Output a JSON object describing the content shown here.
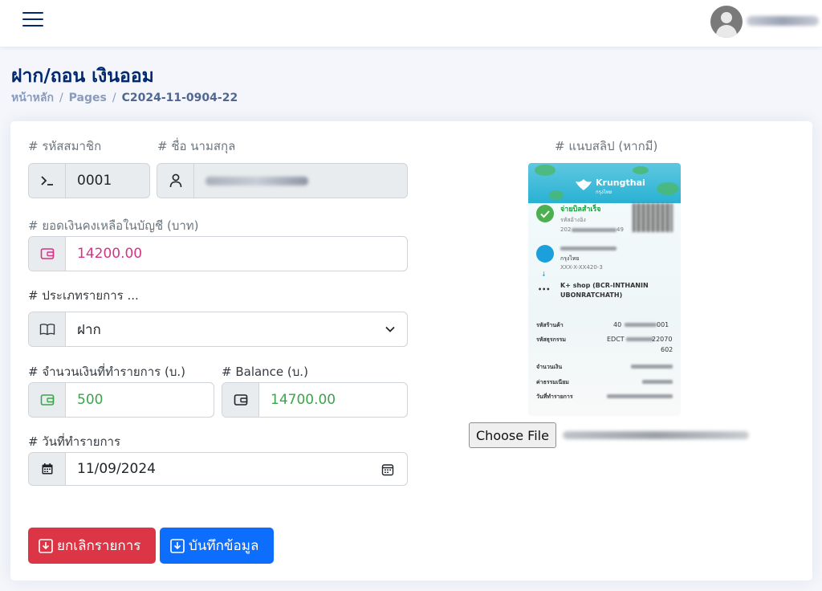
{
  "topbar": {
    "menu_icon": "hamburger-icon",
    "avatar_icon": "user-avatar-icon"
  },
  "page": {
    "title": "ฝาก/ถอน เงินออม",
    "breadcrumb": {
      "home": "หน้าหลัก",
      "section": "Pages",
      "current": "C2024-11-0904-22",
      "separator": "/"
    }
  },
  "form": {
    "member_code_label": "# รหัสสมาชิก",
    "member_code_value": "0001",
    "name_label": "# ชื่อ นามสกุล",
    "balance_label": "# ยอดเงินคงเหลือในบัญชี (บาท)",
    "balance_value": "14200.00",
    "type_label": "# ประเภทรายการ ...",
    "type_selected": "ฝาก",
    "amount_label": "# จำนวนเงินที่ทำรายการ (บ.)",
    "amount_value": "500",
    "new_balance_label": "# Balance (บ.)",
    "new_balance_value": "14700.00",
    "date_label": "# วันที่ทำรายการ",
    "date_value": "11/09/2024"
  },
  "slip": {
    "label": "# แนบสลิป (หากมี)",
    "bank_name": "Krungthai",
    "bank_name_thai": "กรุงไทย",
    "status_text": "จ่ายบิลสำเร็จ",
    "ref_label": "รหัสอ้างอิง",
    "ref_prefix": "202",
    "ref_suffix": "49",
    "from_bank": "กรุงไทย",
    "from_account": "XXX-X-XX420-3",
    "payee_line1": "K+ shop (BCR-INTHANIN",
    "payee_line2": "UBONRATCHATH)",
    "store_code_label": "รหัสร้านค้า",
    "store_code_prefix": "40",
    "store_code_suffix": "001",
    "txn_code_label": "รหัสธุรกรรม",
    "txn_code_prefix": "EDCT",
    "txn_code_suffix": "22070",
    "txn_code_line2": "602",
    "amount_label": "จำนวนเงิน",
    "fee_label": "ค่าธรรมเนียม",
    "date_label": "วันที่ทำรายการ",
    "choose_file_label": "Choose File"
  },
  "buttons": {
    "cancel_label": "ยกเลิกรายการ",
    "save_label": "บันทึกข้อมูล"
  },
  "colors": {
    "navy": "#012970",
    "danger": "#dc3545",
    "primary": "#0d6efd",
    "balance_red": "#d63384",
    "amount_green": "#3aa54a"
  }
}
